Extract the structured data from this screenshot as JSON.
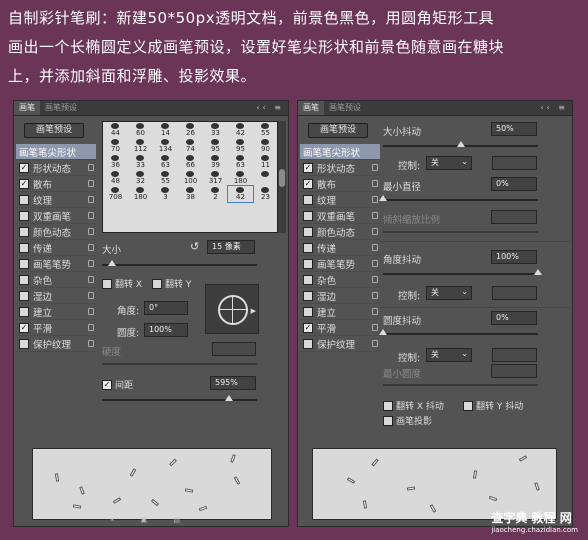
{
  "intro": {
    "line1": "自制彩针笔刷：新建50*50px透明文档，前景色黑色，用圆角矩形工具",
    "line2": "画出一个长椭圆定义成画笔预设，设置好笔尖形状和前景色随意画在糖块",
    "line3": "上，并添加斜面和浮雕、投影效果。"
  },
  "left_panel": {
    "tab_active": "画笔",
    "tab_other": "画笔预设",
    "preset_button": "画笔预设",
    "list": [
      {
        "label": "画笔笔尖形状",
        "checked": null
      },
      {
        "label": "形状动态",
        "checked": true
      },
      {
        "label": "散布",
        "checked": true
      },
      {
        "label": "纹理",
        "checked": false
      },
      {
        "label": "双重画笔",
        "checked": false
      },
      {
        "label": "颜色动态",
        "checked": false
      },
      {
        "label": "传递",
        "checked": false
      },
      {
        "label": "画笔笔势",
        "checked": false
      },
      {
        "label": "杂色",
        "checked": false
      },
      {
        "label": "湿边",
        "checked": false
      },
      {
        "label": "建立",
        "checked": false
      },
      {
        "label": "平滑",
        "checked": true
      },
      {
        "label": "保护纹理",
        "checked": false
      }
    ],
    "brush_sizes": [
      "44",
      "60",
      "14",
      "26",
      "33",
      "42",
      "55",
      "70",
      "112",
      "134",
      "74",
      "95",
      "95",
      "90",
      "36",
      "33",
      "63",
      "66",
      "39",
      "63",
      "11",
      "48",
      "32",
      "55",
      "100",
      "317",
      "180",
      "",
      "708",
      "180",
      "3",
      "38",
      "2",
      "42",
      "23"
    ],
    "size_label": "大小",
    "size_value": "15 像素",
    "flip_x": "翻转 X",
    "flip_y": "翻转 Y",
    "angle_label": "角度:",
    "angle_value": "0°",
    "roundness_label": "圆度:",
    "roundness_value": "100%",
    "hardness_label": "硬度",
    "spacing_label": "间距",
    "spacing_value": "595%",
    "spacing_checked": true
  },
  "right_panel": {
    "tab_active": "画笔",
    "tab_other": "画笔预设",
    "preset_button": "画笔预设",
    "list": [
      {
        "label": "画笔笔尖形状",
        "checked": null
      },
      {
        "label": "形状动态",
        "checked": true
      },
      {
        "label": "散布",
        "checked": true
      },
      {
        "label": "纹理",
        "checked": false
      },
      {
        "label": "双重画笔",
        "checked": false
      },
      {
        "label": "颜色动态",
        "checked": false
      },
      {
        "label": "传递",
        "checked": false
      },
      {
        "label": "画笔笔势",
        "checked": false
      },
      {
        "label": "杂色",
        "checked": false
      },
      {
        "label": "湿边",
        "checked": false
      },
      {
        "label": "建立",
        "checked": false
      },
      {
        "label": "平滑",
        "checked": true
      },
      {
        "label": "保护纹理",
        "checked": false
      }
    ],
    "size_jitter_label": "大小抖动",
    "size_jitter_value": "50%",
    "control_label": "控制:",
    "control_value": "关",
    "min_diameter_label": "最小直径",
    "min_diameter_value": "0%",
    "tilt_scale_label": "倾斜缩放比例",
    "angle_jitter_label": "角度抖动",
    "angle_jitter_value": "100%",
    "control2_value": "关",
    "roundness_jitter_label": "圆度抖动",
    "roundness_jitter_value": "0%",
    "control3_value": "关",
    "min_roundness_label": "最小圆度",
    "flip_x_jitter": "翻转 X 抖动",
    "flip_y_jitter": "翻转 Y 抖动",
    "brush_projection": "画笔投影"
  },
  "watermark": {
    "main": "查字典 教程 网",
    "sub": "jiaocheng.chazidian.com"
  }
}
